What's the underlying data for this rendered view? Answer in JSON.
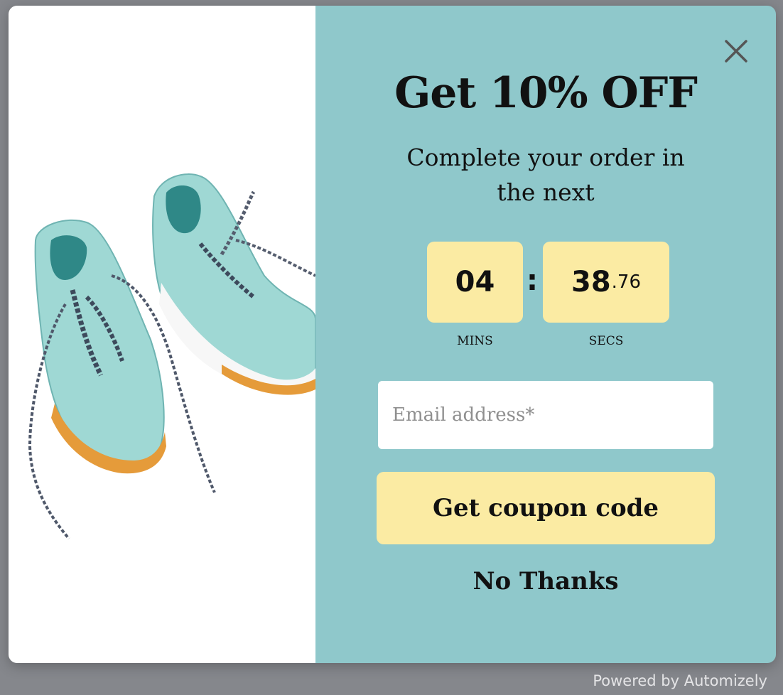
{
  "popup": {
    "headline": "Get 10% OFF",
    "subline": "Complete your order in the next",
    "close_icon": "close-icon",
    "image": "watercolor-sneakers"
  },
  "timer": {
    "minutes": "04",
    "seconds": "38",
    "seconds_fraction": ".76",
    "minutes_label": "MINS",
    "seconds_label": "SECS",
    "separator": ":"
  },
  "form": {
    "email_placeholder": "Email address*",
    "email_value": "",
    "submit_label": "Get coupon code",
    "dismiss_label": "No Thanks"
  },
  "footer": {
    "powered_by": "Powered by Automizely"
  },
  "colors": {
    "backdrop": "#85878c",
    "panel": "#8fc8cb",
    "accent": "#fbeba3",
    "text": "#111111"
  }
}
